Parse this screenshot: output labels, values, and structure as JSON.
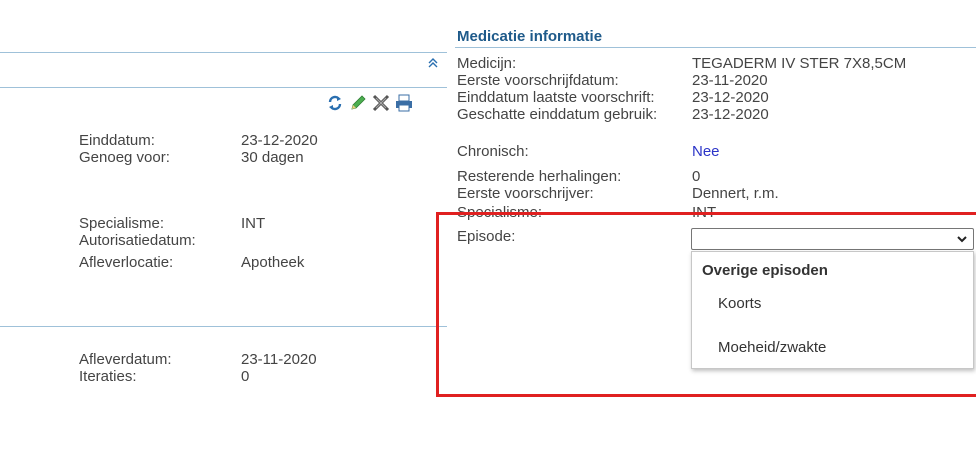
{
  "left_panel": {
    "fields": [
      {
        "label": "Einddatum:",
        "value": "23-12-2020"
      },
      {
        "label": "Genoeg voor:",
        "value": "30 dagen"
      },
      {
        "label": "Specialisme:",
        "value": "INT"
      },
      {
        "label": "Autorisatiedatum:",
        "value": ""
      },
      {
        "label": "Afleverlocatie:",
        "value": "Apotheek"
      },
      {
        "label": "Afleverdatum:",
        "value": "23-11-2020"
      },
      {
        "label": "Iteraties:",
        "value": "0"
      }
    ]
  },
  "toolbar": {
    "icons": [
      "refresh-icon",
      "edit-pencil-icon",
      "stop-icon",
      "print-icon"
    ],
    "colors": {
      "refresh": "#2a6fb0",
      "pencil": "#4caf50",
      "stop": "#555555",
      "print": "#3a6ea5"
    }
  },
  "medicatie": {
    "title": "Medicatie informatie",
    "fields": [
      {
        "label": "Medicijn:",
        "value": "TEGADERM IV STER 7X8,5CM"
      },
      {
        "label": "Eerste voorschrijfdatum:",
        "value": "23-11-2020"
      },
      {
        "label": "Einddatum laatste voorschrift:",
        "value": "23-12-2020"
      },
      {
        "label": "Geschatte einddatum gebruik:",
        "value": "23-12-2020"
      },
      {
        "label": "Chronisch:",
        "value": "Nee"
      },
      {
        "label": "Resterende herhalingen:",
        "value": "0"
      },
      {
        "label": "Eerste voorschrijver:",
        "value": "Dennert, r.m."
      },
      {
        "label": "Specialisme:",
        "value": "INT"
      },
      {
        "label": "Episode:",
        "value": ""
      }
    ],
    "episode_select": {
      "selected": "",
      "dropdown": {
        "group_label": "Overige episoden",
        "options": [
          "Koorts",
          "Moeheid/zwakte"
        ]
      }
    }
  },
  "colors": {
    "accent": "#1e5a8a",
    "divider": "#9fc1d9",
    "highlight": "#e02020",
    "link": "#2b34c8"
  }
}
